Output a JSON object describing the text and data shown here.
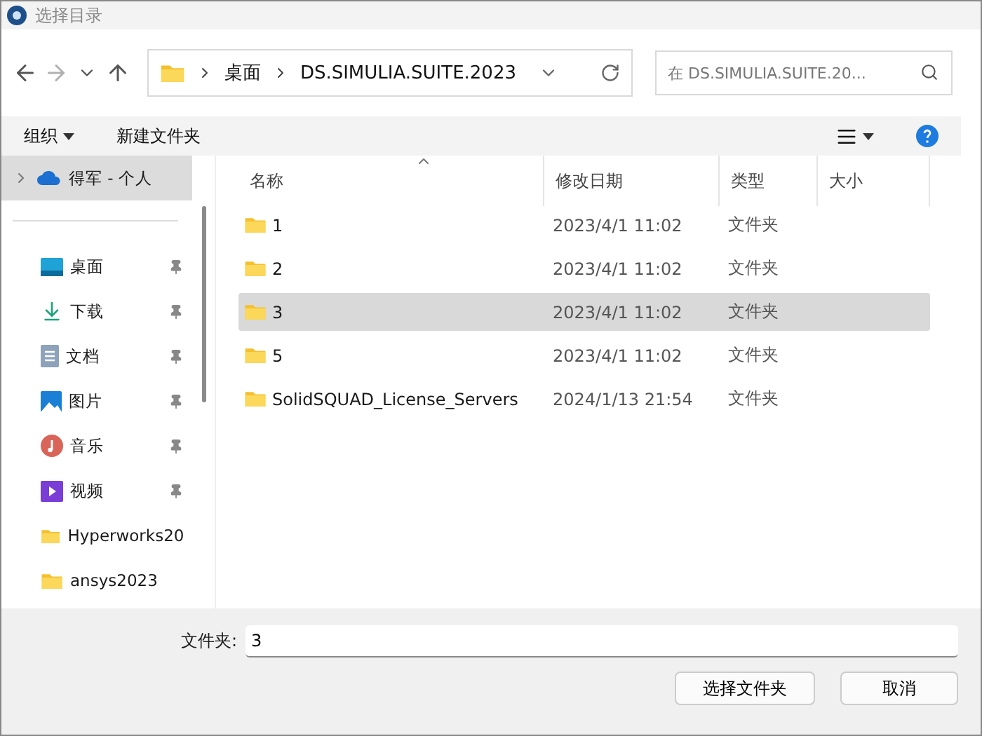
{
  "window": {
    "title": "选择目录"
  },
  "nav": {
    "buttons": [
      {
        "kind": "back",
        "disabled": false
      },
      {
        "kind": "forward",
        "disabled": true
      },
      {
        "kind": "recent",
        "disabled": false
      },
      {
        "kind": "up",
        "disabled": false
      }
    ],
    "breadcrumb": [
      "桌面",
      "DS.SIMULIA.SUITE.2023"
    ],
    "search": {
      "placeholder": "在 DS.SIMULIA.SUITE.20..."
    }
  },
  "toolbar": {
    "organize": "组织",
    "new_folder": "新建文件夹"
  },
  "sidebar": {
    "items": [
      {
        "kind": "cloud",
        "label": "得军 - 个人",
        "selected": true,
        "pinned": false
      },
      {
        "kind": "desktop",
        "label": "桌面",
        "selected": false,
        "pinned": true
      },
      {
        "kind": "download",
        "label": "下载",
        "selected": false,
        "pinned": true
      },
      {
        "kind": "documents",
        "label": "文档",
        "selected": false,
        "pinned": true
      },
      {
        "kind": "pictures",
        "label": "图片",
        "selected": false,
        "pinned": true
      },
      {
        "kind": "music",
        "label": "音乐",
        "selected": false,
        "pinned": true
      },
      {
        "kind": "videos",
        "label": "视频",
        "selected": false,
        "pinned": true
      },
      {
        "kind": "folder",
        "label": "Hyperworks20",
        "selected": false,
        "pinned": false
      },
      {
        "kind": "folder",
        "label": "ansys2023",
        "selected": false,
        "pinned": false
      }
    ]
  },
  "table": {
    "columns": [
      {
        "label": "名称",
        "sorted": true
      },
      {
        "label": "修改日期",
        "sorted": false
      },
      {
        "label": "类型",
        "sorted": false
      },
      {
        "label": "大小",
        "sorted": false
      }
    ],
    "rows": [
      {
        "name": "1",
        "date": "2023/4/1 11:02",
        "type": "文件夹",
        "selected": false
      },
      {
        "name": "2",
        "date": "2023/4/1 11:02",
        "type": "文件夹",
        "selected": false
      },
      {
        "name": "3",
        "date": "2023/4/1 11:02",
        "type": "文件夹",
        "selected": true
      },
      {
        "name": "5",
        "date": "2023/4/1 11:02",
        "type": "文件夹",
        "selected": false
      },
      {
        "name": "SolidSQUAD_License_Servers",
        "date": "2024/1/13 21:54",
        "type": "文件夹",
        "selected": false
      }
    ]
  },
  "footer": {
    "label": "文件夹:",
    "value": "3",
    "buttons": [
      "选择文件夹",
      "取消"
    ]
  }
}
